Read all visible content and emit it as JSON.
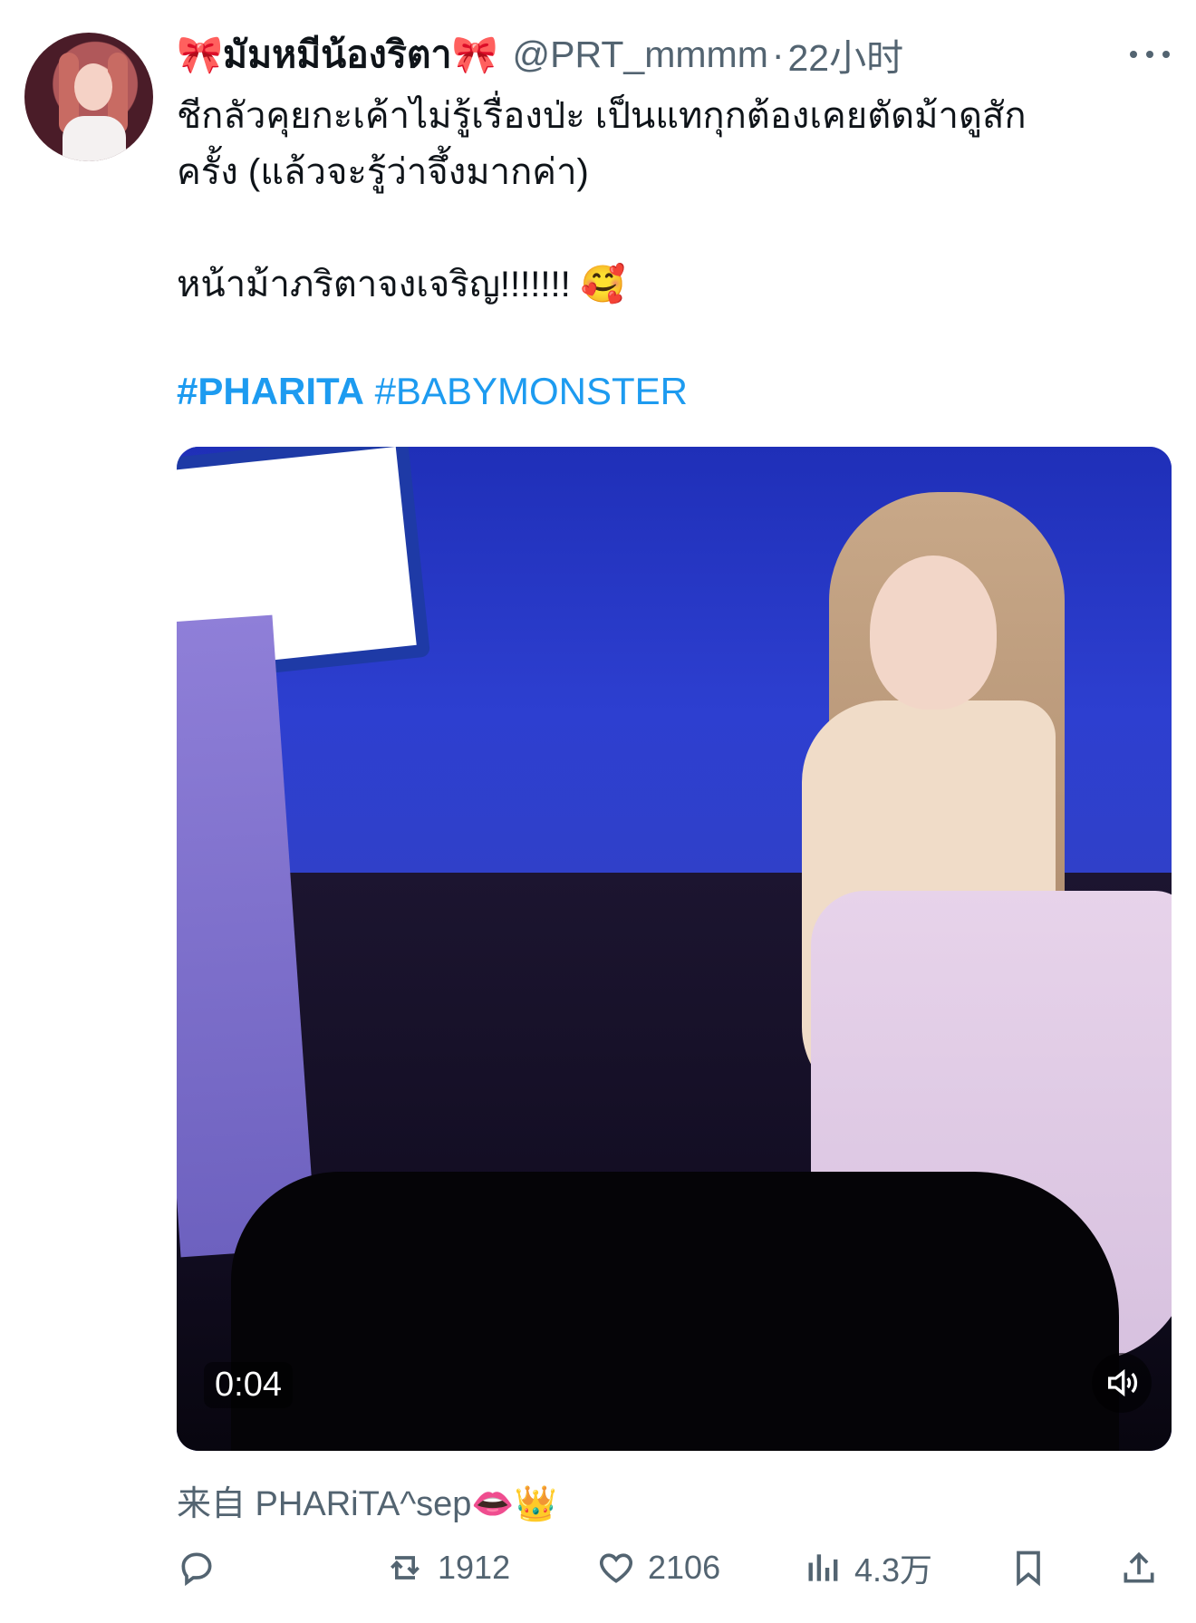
{
  "tweet": {
    "display_name": "🎀มัมหมีน้องริตา🎀",
    "handle": "@PRT_mmmm",
    "separator": "·",
    "time": "22小时",
    "text_lines": [
      "ชีกลัวคุยกะเค้าไม่รู้เรื่องป่ะ เป็นแทกุกต้องเคยตัดม้าดูสัก",
      "ครั้ง (แล้วจะรู้ว่าจึ้งมากค่า)",
      "หน้าม้าภริตาจงเจริญ!!!!!!! 🥰"
    ],
    "hashtags": [
      "#PHARITA",
      "#BABYMONSTER"
    ],
    "video": {
      "time": "0:04"
    },
    "source": "来自 PHARiTA^sep👄👑",
    "actions": {
      "replies": "",
      "retweets": "1912",
      "likes": "2106",
      "views": "4.3万"
    }
  }
}
